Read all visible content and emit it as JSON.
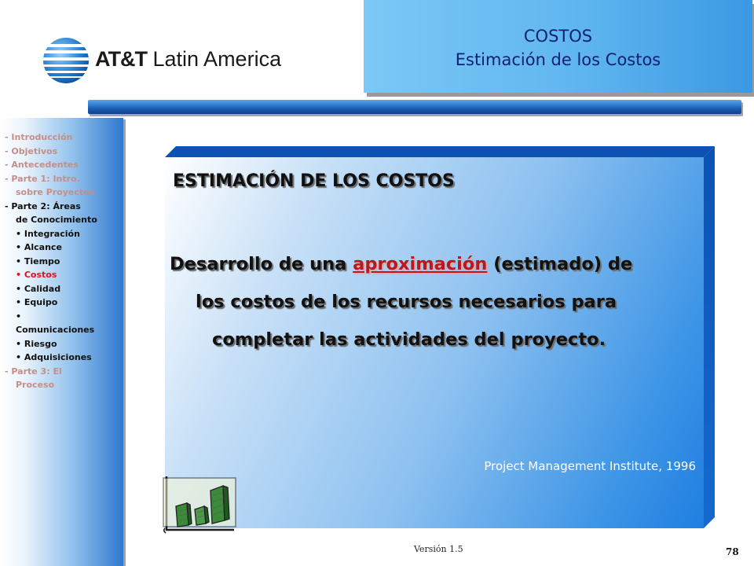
{
  "logo": {
    "brand": "AT&T",
    "region": "Latin America",
    "icon": "globe-icon"
  },
  "header": {
    "title": "COSTOS",
    "subtitle": "Estimación de los Costos",
    "color": "#0d2270"
  },
  "nav": {
    "items": [
      {
        "label": "- Introducción",
        "state": "faded"
      },
      {
        "label": "- Objetivos",
        "state": "faded"
      },
      {
        "label": "- Antecedentes",
        "state": "faded"
      },
      {
        "label": "- Parte 1: Intro.",
        "state": "faded"
      },
      {
        "label": "sobre Proyectos",
        "state": "faded"
      },
      {
        "label": "- Parte 2: Áreas",
        "state": "normal"
      },
      {
        "label": "de Conocimiento",
        "state": "normal"
      },
      {
        "label": "• Integración",
        "state": "normal"
      },
      {
        "label": "• Alcance",
        "state": "normal"
      },
      {
        "label": "• Tiempo",
        "state": "normal"
      },
      {
        "label": "• Costos",
        "state": "active"
      },
      {
        "label": "• Calidad",
        "state": "normal"
      },
      {
        "label": "• Equipo",
        "state": "normal"
      },
      {
        "label": "•",
        "state": "normal"
      },
      {
        "label": "Comunicaciones",
        "state": "normal"
      },
      {
        "label": "• Riesgo",
        "state": "normal"
      },
      {
        "label": "• Adquisiciones",
        "state": "normal"
      },
      {
        "label": "- Parte 3: El",
        "state": "faded"
      },
      {
        "label": "Proceso",
        "state": "faded"
      }
    ],
    "active_color": "#e3101a"
  },
  "main": {
    "heading": "ESTIMACIÓN DE LOS COSTOS",
    "body_before": "Desarrollo de una ",
    "body_highlight": "aproximación",
    "body_after": " (estimado) de",
    "body_line2": "los costos de los recursos necesarios para",
    "body_line3": "completar las actividades del proyecto.",
    "source": "Project Management Institute, 1996",
    "highlight_color": "#c0151d"
  },
  "clipart": {
    "icon": "bar-chart-icon"
  },
  "footer": {
    "version": "Versión 1.5",
    "page": "78"
  }
}
